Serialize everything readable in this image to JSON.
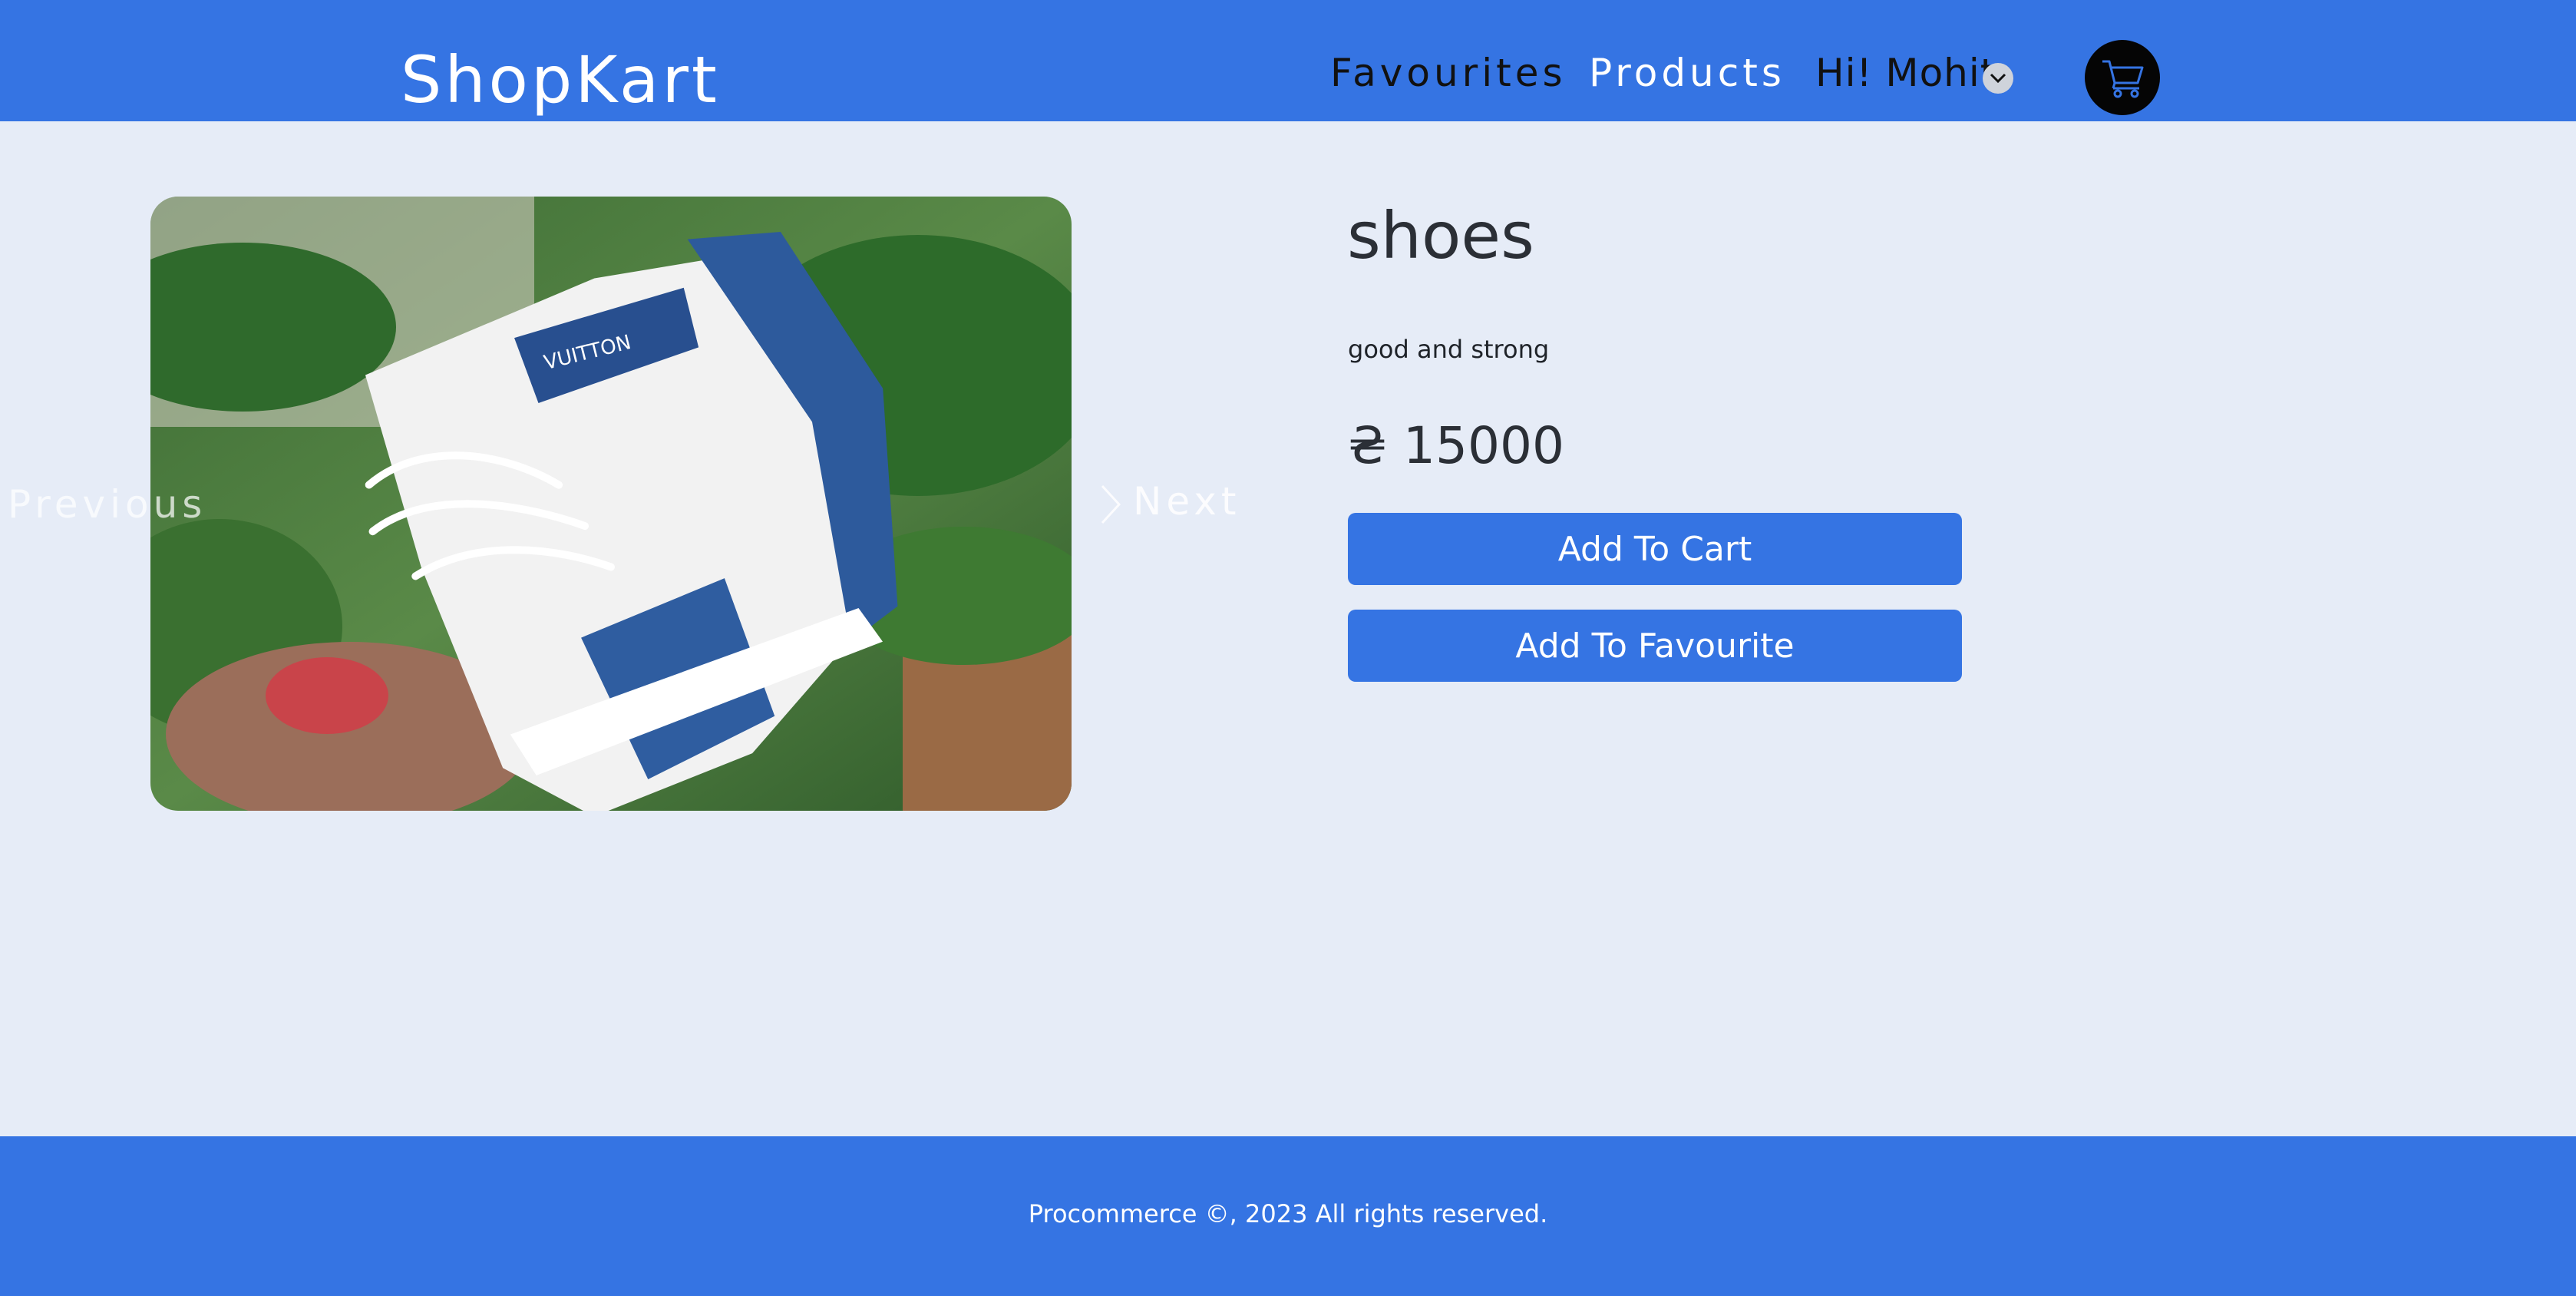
{
  "header": {
    "brand": "ShopKart",
    "nav": {
      "favourites": "Favourites",
      "products": "Products",
      "user_greeting": "Hi! Mohit"
    },
    "icons": {
      "user_dropdown": "chevron-down-icon",
      "cart": "shopping-cart-icon"
    }
  },
  "carousel": {
    "previous_label": "Previous",
    "next_label": "Next",
    "next_icon": "chevron-right-icon"
  },
  "product": {
    "name": "shoes",
    "description": "good and strong",
    "price": "₴ 15000"
  },
  "actions": {
    "add_to_cart": "Add To Cart",
    "add_to_favourite": "Add To Favourite"
  },
  "footer": {
    "copyright": "Procommerce ©, 2023 All rights reserved."
  },
  "colors": {
    "primary": "#3574e3",
    "page_background": "#e6ecf7",
    "cart_button": "#050505"
  }
}
